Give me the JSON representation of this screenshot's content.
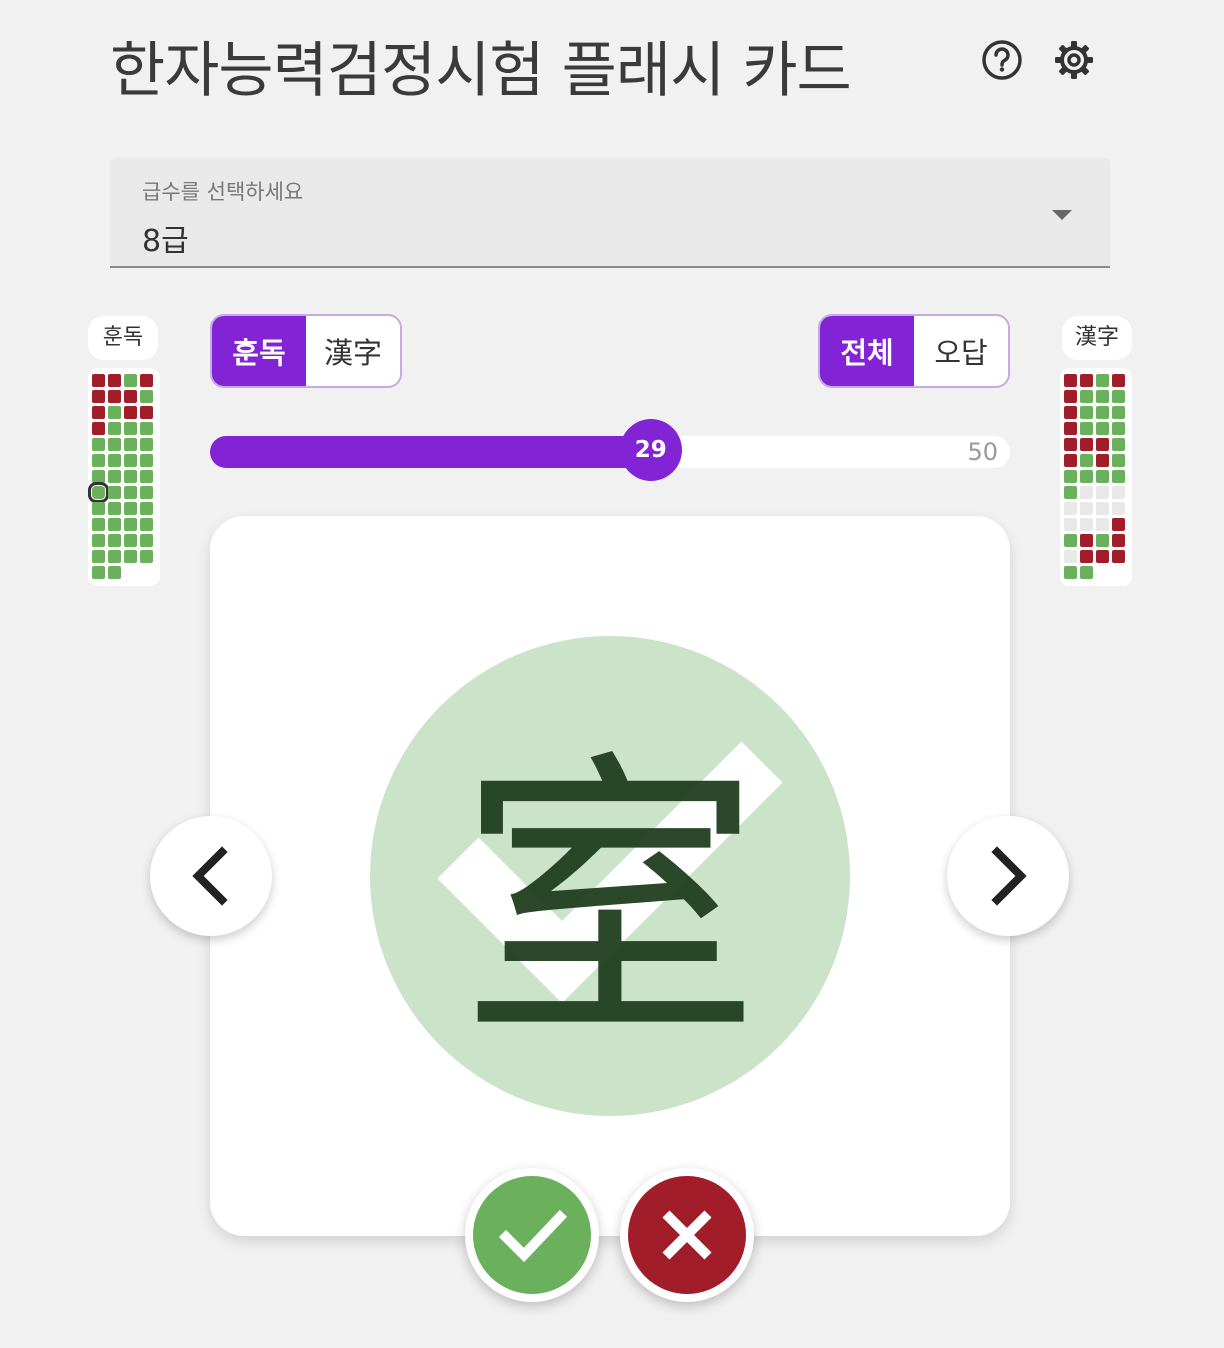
{
  "header": {
    "title": "한자능력검정시험 플래시 카드",
    "help_icon": "help-circle-icon",
    "settings_icon": "gear-icon"
  },
  "level_select": {
    "label": "급수를 선택하세요",
    "value": "8급"
  },
  "left_panel": {
    "label": "훈독",
    "cells": [
      "r",
      "r",
      "g",
      "r",
      "r",
      "r",
      "r",
      "g",
      "r",
      "g",
      "r",
      "r",
      "r",
      "g",
      "g",
      "g",
      "g",
      "g",
      "g",
      "g",
      "g",
      "g",
      "g",
      "g",
      "g",
      "g",
      "g",
      "g",
      "g",
      "g",
      "g",
      "g",
      "g",
      "g",
      "g",
      "g",
      "g",
      "g",
      "g",
      "g",
      "g",
      "g",
      "g",
      "g",
      "g",
      "g",
      "g",
      "g",
      "g",
      "g",
      "g",
      "g",
      "g",
      "g",
      "g",
      "g",
      "g",
      "g",
      "g",
      "g",
      "g",
      "g",
      "g",
      "g",
      "g",
      "g",
      "g",
      "g",
      "g",
      "g",
      "g",
      "g",
      "g",
      "g",
      "g",
      "g",
      "g",
      "g",
      "g",
      "g",
      "g",
      "g",
      "g",
      "g",
      "g",
      "g",
      "g",
      "g",
      "g",
      "g",
      "g",
      "g",
      "g",
      "g",
      "g",
      "g",
      "g",
      "g",
      "g",
      "g",
      "g",
      "g",
      "g",
      "g",
      "g",
      "g",
      "g",
      "g",
      "g",
      "g",
      "g",
      "g",
      "g",
      "g",
      "g",
      "g",
      "g",
      "g",
      "g",
      "g",
      "g",
      "g",
      "g",
      "g",
      "g",
      "g",
      "g",
      "g",
      "g",
      "g",
      "g",
      "g",
      "g",
      "g",
      "g",
      "g",
      "g",
      "g",
      "g",
      "g",
      "g",
      "g",
      "g",
      "g",
      "g",
      "g",
      "g",
      "g",
      "g",
      "g",
      "g",
      "g",
      "g",
      "g",
      "g",
      "g",
      "g",
      "g",
      "g",
      "g",
      "g",
      "g",
      "g",
      "g",
      "g",
      "g",
      "g",
      "g",
      "g",
      "g",
      "g",
      "g",
      "g",
      "g",
      "g",
      "g",
      "g",
      "g",
      "g",
      "g",
      "g",
      "g",
      "g",
      "g",
      "g",
      "g",
      "g",
      "g",
      "g",
      "g",
      "g",
      "g",
      "g",
      "g",
      "g",
      "g",
      "g",
      "g",
      "g",
      "g",
      "g",
      "g",
      "g",
      "g",
      "g",
      "g",
      "g",
      "g",
      "g",
      "g",
      "g",
      "g",
      "g",
      "g",
      "g",
      "g",
      "g",
      "g",
      "g",
      "g",
      "g",
      "g",
      "g",
      "g",
      "g",
      "g",
      "g",
      "g",
      "g",
      "g",
      "g",
      "g",
      "g",
      "g",
      "g",
      "g",
      "g",
      "g",
      "g",
      "g",
      "g",
      "g",
      "g",
      "g",
      "g",
      "g",
      "g",
      "g",
      "g",
      "g",
      "g",
      "g",
      "g",
      "g",
      "g",
      "g",
      "g",
      "g",
      "g",
      "g",
      "g",
      "g",
      "g",
      "g",
      "g",
      "g",
      "g",
      "g",
      "g",
      "g",
      "g",
      "g",
      "g",
      "g",
      "g",
      "g",
      "g",
      "g",
      "g",
      "g",
      "g"
    ],
    "current_index": 28
  },
  "right_panel": {
    "label": "漢字",
    "cells": [
      "r",
      "r",
      "g",
      "r",
      "r",
      "g",
      "g",
      "g",
      "r",
      "g",
      "g",
      "g",
      "r",
      "g",
      "g",
      "g",
      "r",
      "r",
      "r",
      "g",
      "r",
      "g",
      "r",
      "g",
      "g",
      "g",
      "g",
      "g",
      "g",
      "e",
      "e",
      "e",
      "e",
      "e",
      "e",
      "e",
      "e",
      "e",
      "e",
      "r",
      "g",
      "r",
      "g",
      "r",
      "e",
      "r",
      "r",
      "r",
      "g",
      "g"
    ]
  },
  "mode_toggle": {
    "options": [
      "훈독",
      "漢字"
    ],
    "selected": 0
  },
  "filter_toggle": {
    "options": [
      "전체",
      "오답"
    ],
    "selected": 0
  },
  "progress": {
    "current": 29,
    "total": 50,
    "current_label": "29",
    "max_label": "50"
  },
  "card": {
    "character": "室",
    "result": "correct",
    "result_icon": "checkmark-icon"
  },
  "buttons": {
    "prev_icon": "chevron-left-icon",
    "next_icon": "chevron-right-icon",
    "correct_icon": "check-icon",
    "wrong_icon": "close-icon"
  },
  "colors": {
    "accent": "#8224d6",
    "correct": "#6ab05d",
    "wrong": "#a11d2a",
    "result_bg": "#cbe3c9"
  }
}
